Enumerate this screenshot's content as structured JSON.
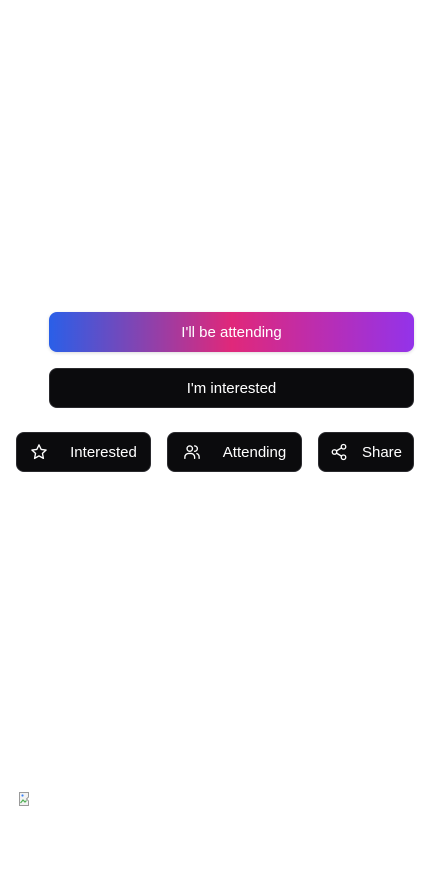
{
  "actions": {
    "attending_label": "I'll be attending",
    "interested_label": "I'm interested"
  },
  "quick_actions": {
    "interested_label": "Interested",
    "attending_label": "Attending",
    "share_label": "Share"
  },
  "icons": {
    "interested": "star-icon",
    "attending": "users-icon",
    "share": "share-icon",
    "broken_image": "broken-image-icon"
  },
  "colors": {
    "gradient_start": "#2a5fe8",
    "gradient_mid": "#e0287a",
    "gradient_end": "#9333ea",
    "dark_button": "#0b0b0d"
  }
}
